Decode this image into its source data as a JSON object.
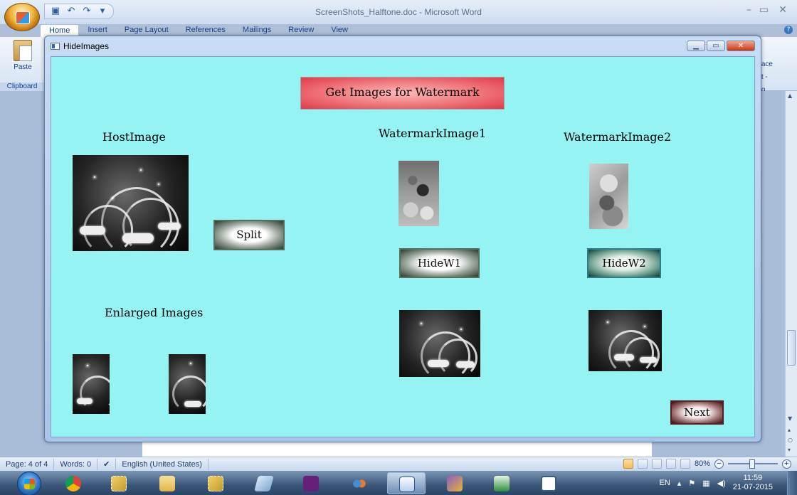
{
  "word": {
    "title": "ScreenShots_Halftone.doc - Microsoft Word",
    "tabs": [
      "Home",
      "Insert",
      "Page Layout",
      "References",
      "Mailings",
      "Review",
      "View"
    ],
    "paste_label": "Paste",
    "clipboard_label": "Clipboard",
    "ribbon_right_fragments": [
      "ace",
      "t -",
      "g"
    ],
    "status": {
      "page": "Page: 4 of 4",
      "words": "Words: 0",
      "language": "English (United States)",
      "zoom": "80%"
    }
  },
  "dialog": {
    "title": "HideImages",
    "get_images_button": "Get Images for Watermark",
    "host_image_label": "HostImage",
    "watermark1_label": "WatermarkImage1",
    "watermark2_label": "WatermarkImage2",
    "split_button": "Split",
    "hide_w1_button": "HideW1",
    "hide_w2_button": "HideW2",
    "enlarged_images_label": "Enlarged Images",
    "next_button": "Next"
  },
  "taskbar": {
    "language": "EN",
    "time": "11:59",
    "date": "21-07-2015"
  },
  "colors": {
    "client_bg": "#96f3f3",
    "get_images_button": "#e2394a"
  }
}
